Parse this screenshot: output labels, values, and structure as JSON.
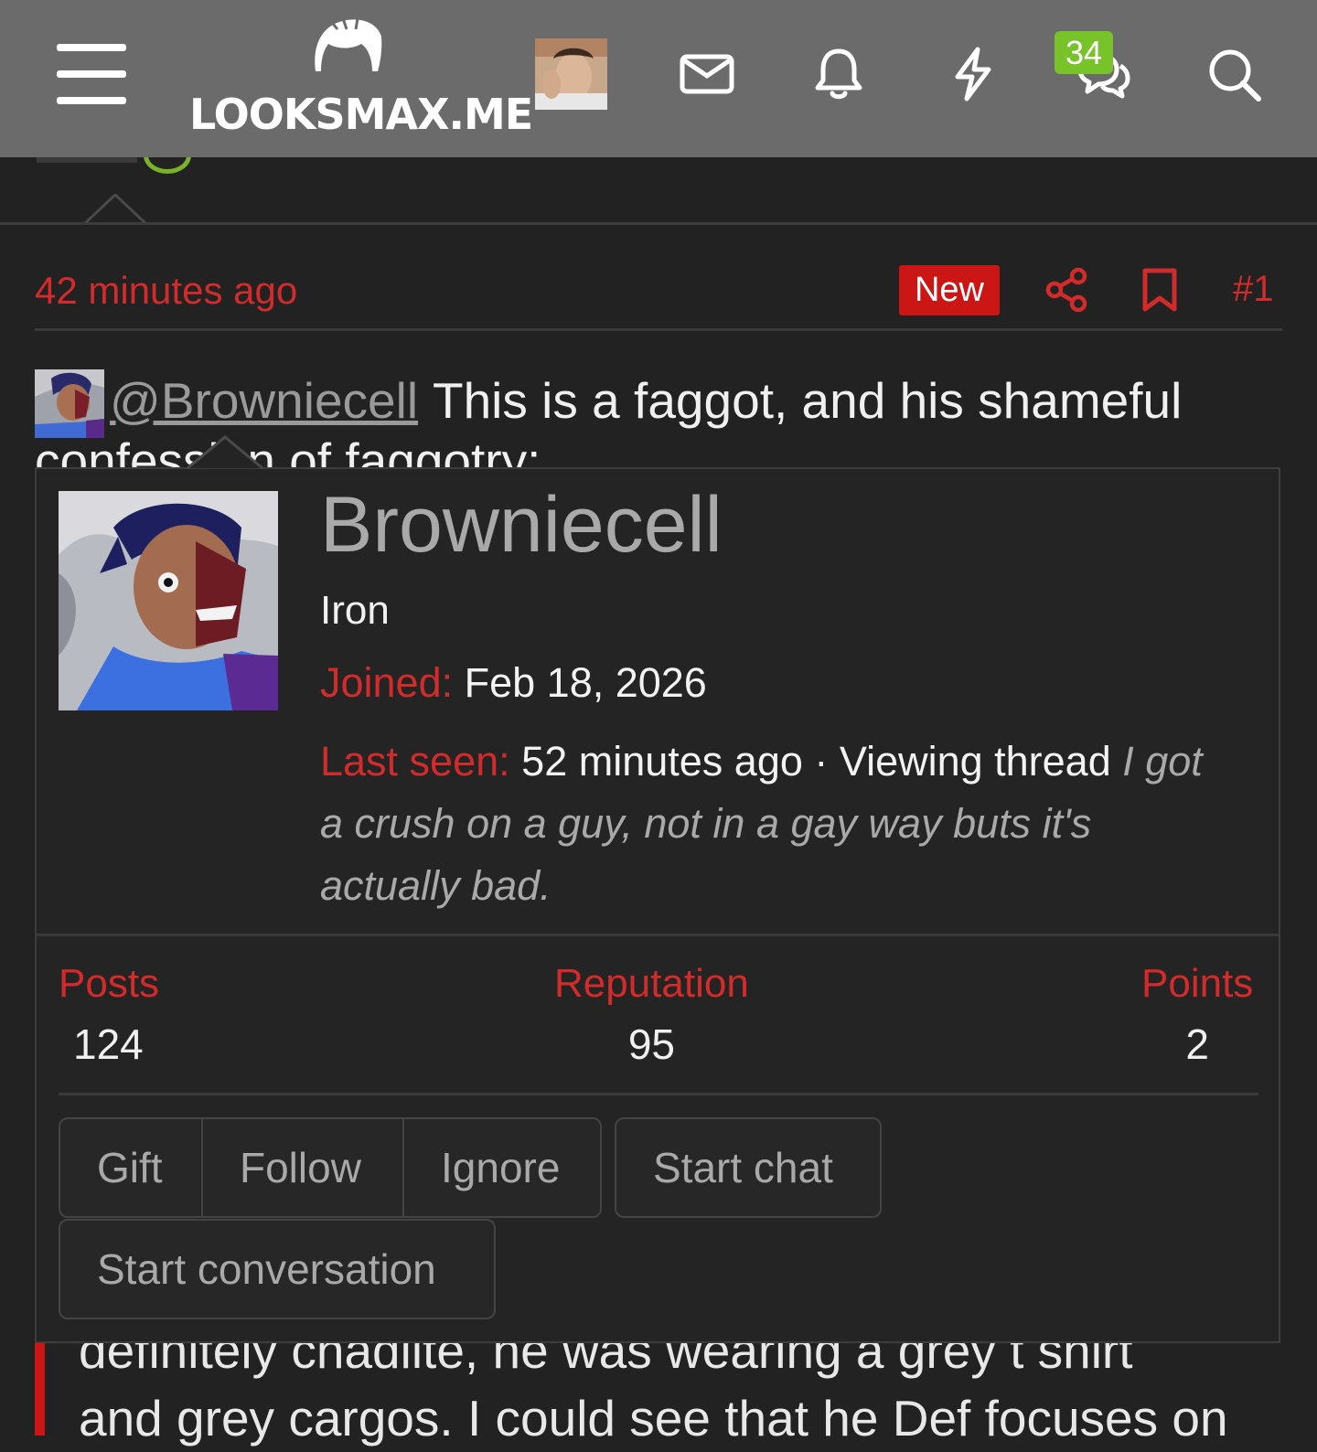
{
  "header": {
    "site_name": "LOOKSMAX.ME",
    "notification_badge": "34",
    "icons": [
      "menu-icon",
      "envelope-icon",
      "bell-icon",
      "lightning-icon",
      "chat-icon",
      "search-icon"
    ]
  },
  "post": {
    "time": "42 minutes ago",
    "new_label": "New",
    "number": "#1",
    "mention": "@Browniecell",
    "text": "This is a faggot, and his shameful",
    "text_clipped": "confession of faggotry:"
  },
  "profile_card": {
    "username": "Browniecell",
    "rank": "Iron",
    "joined_label": "Joined:",
    "joined_value": "Feb 18, 2026",
    "last_seen_label": "Last seen:",
    "last_seen_value": "52 minutes ago · Viewing thread ",
    "thread_title": "I got a crush on a guy, not in a gay way buts it's actually bad.",
    "stats": [
      {
        "label": "Posts",
        "value": "124"
      },
      {
        "label": "Reputation",
        "value": "95"
      },
      {
        "label": "Points",
        "value": "2"
      }
    ],
    "buttons": {
      "gift": "Gift",
      "follow": "Follow",
      "ignore": "Ignore",
      "start_chat": "Start chat",
      "start_conversation": "Start conversation"
    }
  },
  "quote": {
    "line1": "definitely chadlite, he was wearing a grey t shirt",
    "line2": "and grey cargos. I could see that he Def focuses on"
  },
  "colors": {
    "accent_red": "#d22b2b",
    "badge_green": "#79c32a",
    "header_bg": "#6b6b6b",
    "page_bg": "#222223"
  }
}
